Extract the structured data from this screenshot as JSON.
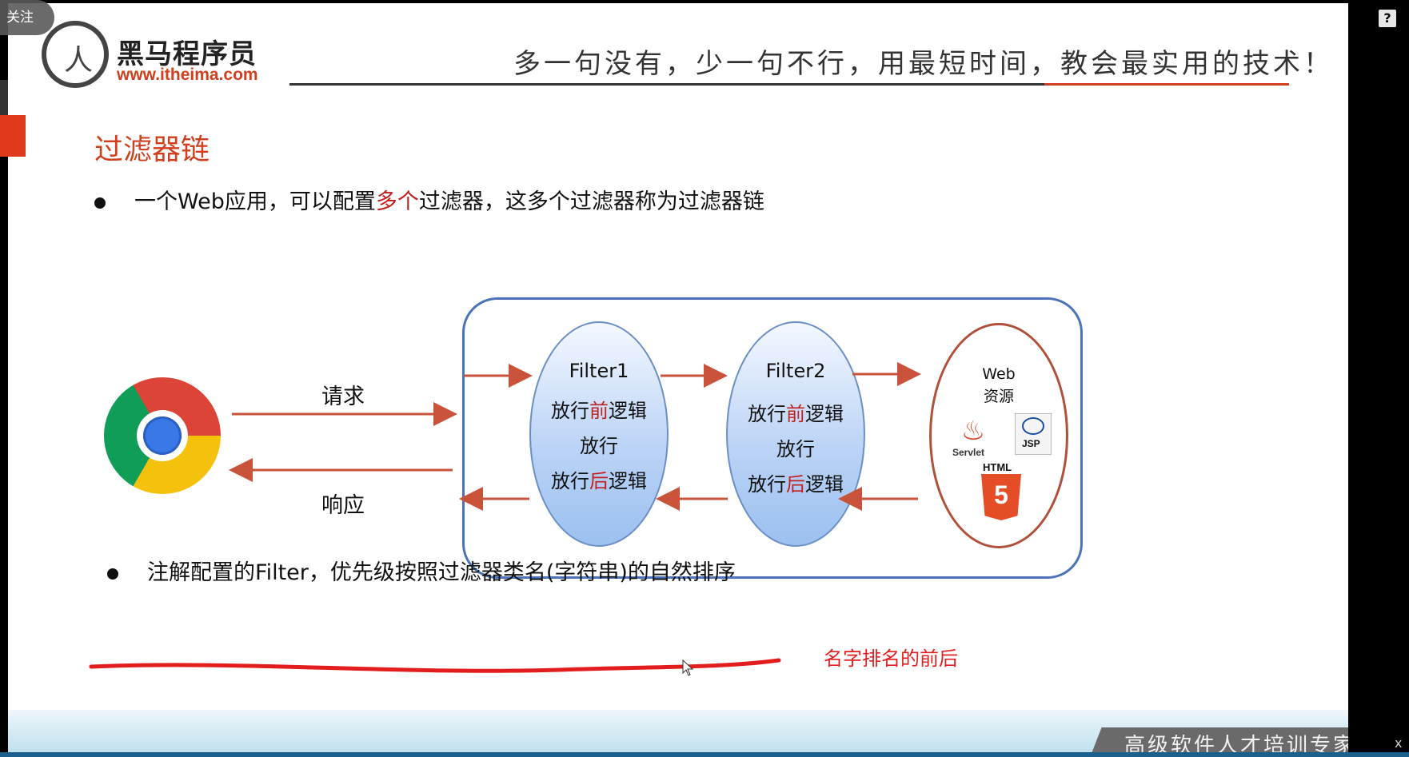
{
  "overlay": {
    "follow_label": "关注",
    "help_icon": "question-mark-icon"
  },
  "header": {
    "logo_name": "黑马程序员",
    "logo_url": "www.itheima.com",
    "slogan": "多一句没有，少一句不行，用最短时间，教会最实用的技术！"
  },
  "slide": {
    "title": "过滤器链",
    "bullet1": {
      "pre": "一个Web应用，可以配置",
      "highlight": "多个",
      "post": "过滤器，这多个过滤器称为过滤器链"
    },
    "bullet2": "注解配置的Filter，优先级按照过滤器类名(字符串)的自然排序",
    "annotation": "名字排名的前后"
  },
  "diagram": {
    "request_label": "请求",
    "response_label": "响应",
    "filter1": {
      "name": "Filter1",
      "pre_a": "放行",
      "pre_b": "前",
      "pre_c": "逻辑",
      "pass": "放行",
      "post_a": "放行",
      "post_b": "后",
      "post_c": "逻辑"
    },
    "filter2": {
      "name": "Filter2",
      "pre_a": "放行",
      "pre_b": "前",
      "pre_c": "逻辑",
      "pass": "放行",
      "post_a": "放行",
      "post_b": "后",
      "post_c": "逻辑"
    },
    "web": {
      "line1": "Web",
      "line2": "资源",
      "servlet": "Servlet",
      "jsp": "JSP",
      "html": "HTML",
      "html5": "5"
    },
    "browser_icon": "chrome-icon"
  },
  "footer": {
    "tagline": "高级软件人才培训专家",
    "close": "x"
  },
  "colors": {
    "accent": "#d0401e",
    "arrow": "#c8533a",
    "box_border": "#4a73b8",
    "highlight": "#c0201e"
  }
}
